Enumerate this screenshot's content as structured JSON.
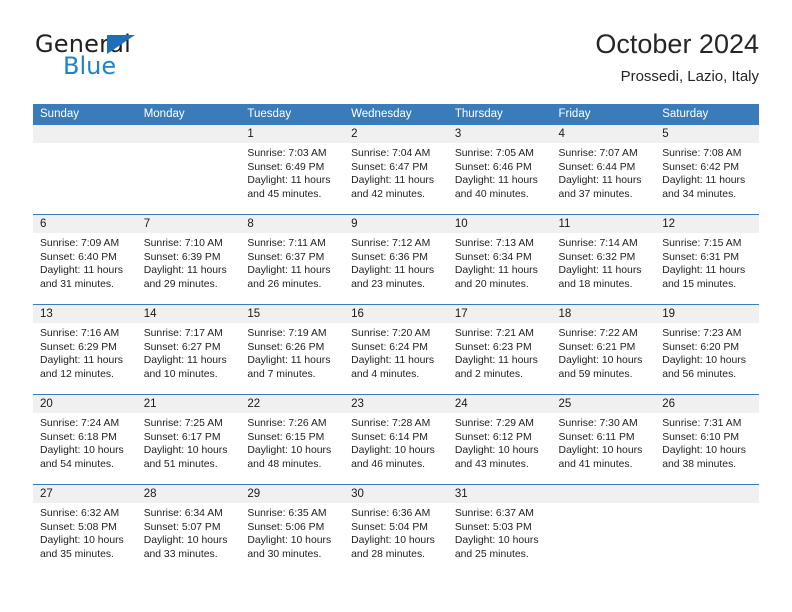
{
  "brand": {
    "name_top": "General",
    "name_bottom": "Blue",
    "accent_color": "#1d84c9",
    "triangle_color": "#1d6fb8"
  },
  "header": {
    "title": "October 2024",
    "subtitle": "Prossedi, Lazio, Italy"
  },
  "theme": {
    "header_blue": "#3a7cba",
    "daynum_gray": "#f0f0f0"
  },
  "weekday_headers": [
    "Sunday",
    "Monday",
    "Tuesday",
    "Wednesday",
    "Thursday",
    "Friday",
    "Saturday"
  ],
  "weeks": [
    [
      {
        "day": "",
        "lines": []
      },
      {
        "day": "",
        "lines": []
      },
      {
        "day": "1",
        "lines": [
          "Sunrise: 7:03 AM",
          "Sunset: 6:49 PM",
          "Daylight: 11 hours",
          "and 45 minutes."
        ]
      },
      {
        "day": "2",
        "lines": [
          "Sunrise: 7:04 AM",
          "Sunset: 6:47 PM",
          "Daylight: 11 hours",
          "and 42 minutes."
        ]
      },
      {
        "day": "3",
        "lines": [
          "Sunrise: 7:05 AM",
          "Sunset: 6:46 PM",
          "Daylight: 11 hours",
          "and 40 minutes."
        ]
      },
      {
        "day": "4",
        "lines": [
          "Sunrise: 7:07 AM",
          "Sunset: 6:44 PM",
          "Daylight: 11 hours",
          "and 37 minutes."
        ]
      },
      {
        "day": "5",
        "lines": [
          "Sunrise: 7:08 AM",
          "Sunset: 6:42 PM",
          "Daylight: 11 hours",
          "and 34 minutes."
        ]
      }
    ],
    [
      {
        "day": "6",
        "lines": [
          "Sunrise: 7:09 AM",
          "Sunset: 6:40 PM",
          "Daylight: 11 hours",
          "and 31 minutes."
        ]
      },
      {
        "day": "7",
        "lines": [
          "Sunrise: 7:10 AM",
          "Sunset: 6:39 PM",
          "Daylight: 11 hours",
          "and 29 minutes."
        ]
      },
      {
        "day": "8",
        "lines": [
          "Sunrise: 7:11 AM",
          "Sunset: 6:37 PM",
          "Daylight: 11 hours",
          "and 26 minutes."
        ]
      },
      {
        "day": "9",
        "lines": [
          "Sunrise: 7:12 AM",
          "Sunset: 6:36 PM",
          "Daylight: 11 hours",
          "and 23 minutes."
        ]
      },
      {
        "day": "10",
        "lines": [
          "Sunrise: 7:13 AM",
          "Sunset: 6:34 PM",
          "Daylight: 11 hours",
          "and 20 minutes."
        ]
      },
      {
        "day": "11",
        "lines": [
          "Sunrise: 7:14 AM",
          "Sunset: 6:32 PM",
          "Daylight: 11 hours",
          "and 18 minutes."
        ]
      },
      {
        "day": "12",
        "lines": [
          "Sunrise: 7:15 AM",
          "Sunset: 6:31 PM",
          "Daylight: 11 hours",
          "and 15 minutes."
        ]
      }
    ],
    [
      {
        "day": "13",
        "lines": [
          "Sunrise: 7:16 AM",
          "Sunset: 6:29 PM",
          "Daylight: 11 hours",
          "and 12 minutes."
        ]
      },
      {
        "day": "14",
        "lines": [
          "Sunrise: 7:17 AM",
          "Sunset: 6:27 PM",
          "Daylight: 11 hours",
          "and 10 minutes."
        ]
      },
      {
        "day": "15",
        "lines": [
          "Sunrise: 7:19 AM",
          "Sunset: 6:26 PM",
          "Daylight: 11 hours",
          "and 7 minutes."
        ]
      },
      {
        "day": "16",
        "lines": [
          "Sunrise: 7:20 AM",
          "Sunset: 6:24 PM",
          "Daylight: 11 hours",
          "and 4 minutes."
        ]
      },
      {
        "day": "17",
        "lines": [
          "Sunrise: 7:21 AM",
          "Sunset: 6:23 PM",
          "Daylight: 11 hours",
          "and 2 minutes."
        ]
      },
      {
        "day": "18",
        "lines": [
          "Sunrise: 7:22 AM",
          "Sunset: 6:21 PM",
          "Daylight: 10 hours",
          "and 59 minutes."
        ]
      },
      {
        "day": "19",
        "lines": [
          "Sunrise: 7:23 AM",
          "Sunset: 6:20 PM",
          "Daylight: 10 hours",
          "and 56 minutes."
        ]
      }
    ],
    [
      {
        "day": "20",
        "lines": [
          "Sunrise: 7:24 AM",
          "Sunset: 6:18 PM",
          "Daylight: 10 hours",
          "and 54 minutes."
        ]
      },
      {
        "day": "21",
        "lines": [
          "Sunrise: 7:25 AM",
          "Sunset: 6:17 PM",
          "Daylight: 10 hours",
          "and 51 minutes."
        ]
      },
      {
        "day": "22",
        "lines": [
          "Sunrise: 7:26 AM",
          "Sunset: 6:15 PM",
          "Daylight: 10 hours",
          "and 48 minutes."
        ]
      },
      {
        "day": "23",
        "lines": [
          "Sunrise: 7:28 AM",
          "Sunset: 6:14 PM",
          "Daylight: 10 hours",
          "and 46 minutes."
        ]
      },
      {
        "day": "24",
        "lines": [
          "Sunrise: 7:29 AM",
          "Sunset: 6:12 PM",
          "Daylight: 10 hours",
          "and 43 minutes."
        ]
      },
      {
        "day": "25",
        "lines": [
          "Sunrise: 7:30 AM",
          "Sunset: 6:11 PM",
          "Daylight: 10 hours",
          "and 41 minutes."
        ]
      },
      {
        "day": "26",
        "lines": [
          "Sunrise: 7:31 AM",
          "Sunset: 6:10 PM",
          "Daylight: 10 hours",
          "and 38 minutes."
        ]
      }
    ],
    [
      {
        "day": "27",
        "lines": [
          "Sunrise: 6:32 AM",
          "Sunset: 5:08 PM",
          "Daylight: 10 hours",
          "and 35 minutes."
        ]
      },
      {
        "day": "28",
        "lines": [
          "Sunrise: 6:34 AM",
          "Sunset: 5:07 PM",
          "Daylight: 10 hours",
          "and 33 minutes."
        ]
      },
      {
        "day": "29",
        "lines": [
          "Sunrise: 6:35 AM",
          "Sunset: 5:06 PM",
          "Daylight: 10 hours",
          "and 30 minutes."
        ]
      },
      {
        "day": "30",
        "lines": [
          "Sunrise: 6:36 AM",
          "Sunset: 5:04 PM",
          "Daylight: 10 hours",
          "and 28 minutes."
        ]
      },
      {
        "day": "31",
        "lines": [
          "Sunrise: 6:37 AM",
          "Sunset: 5:03 PM",
          "Daylight: 10 hours",
          "and 25 minutes."
        ]
      },
      {
        "day": "",
        "lines": []
      },
      {
        "day": "",
        "lines": []
      }
    ]
  ]
}
